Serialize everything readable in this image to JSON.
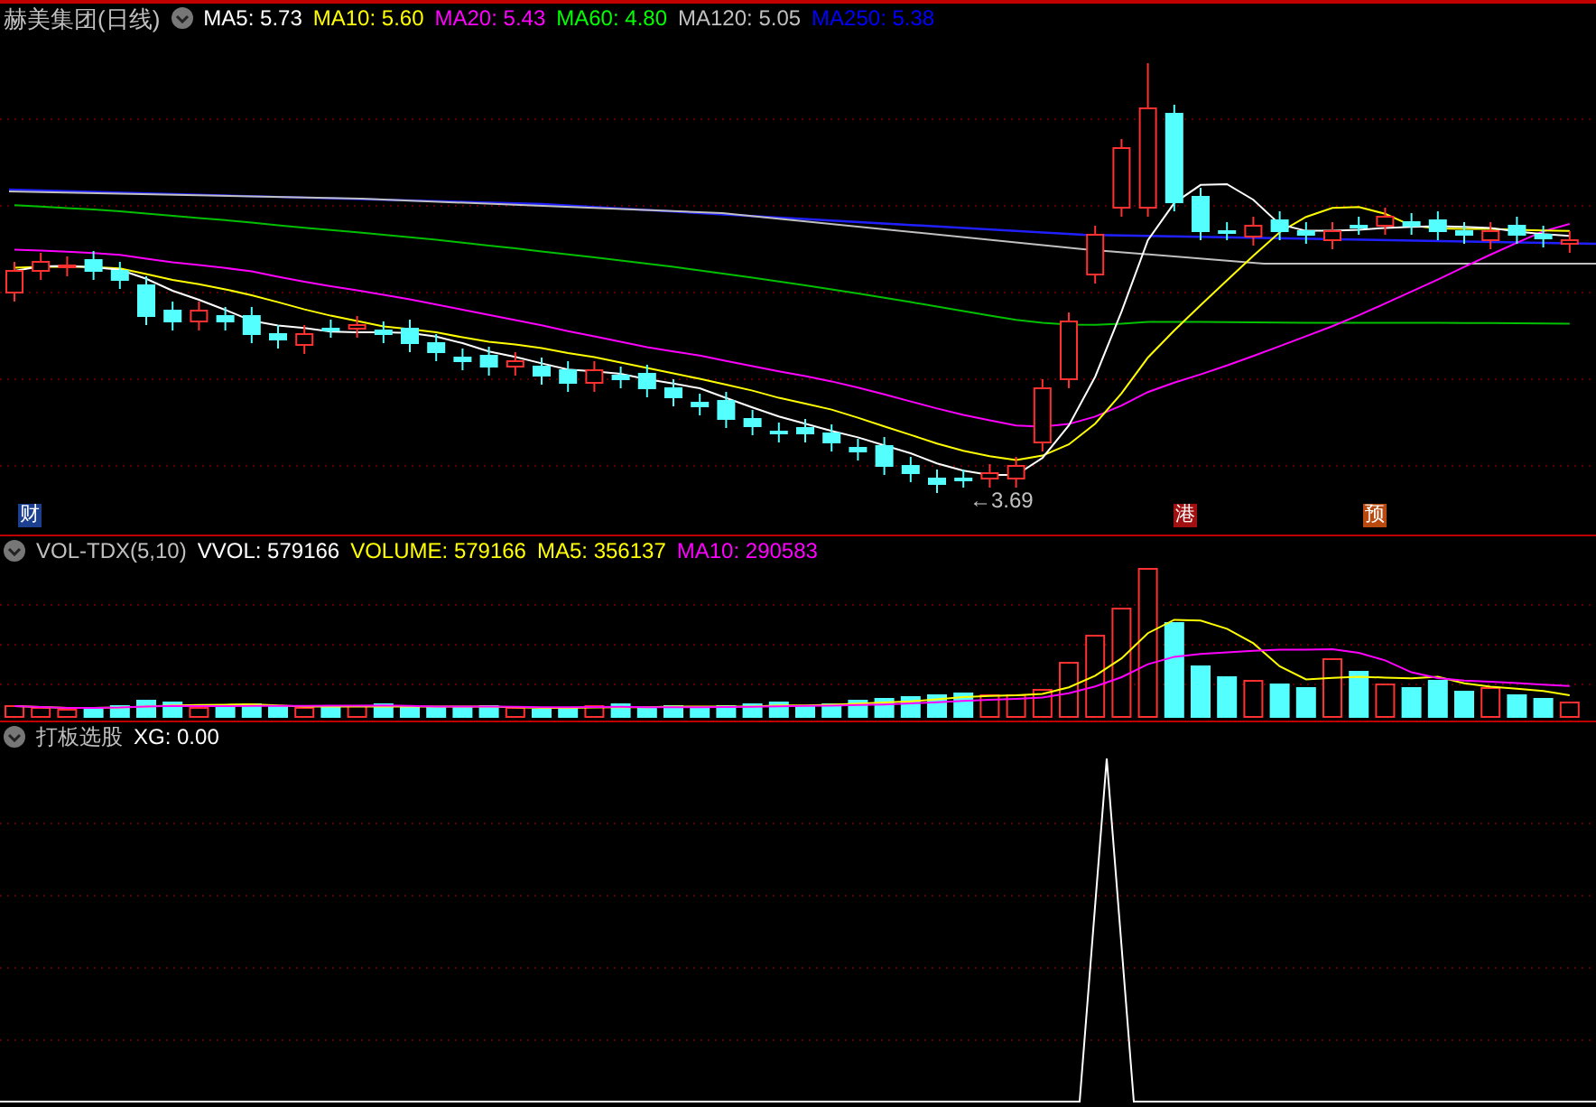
{
  "main_panel": {
    "title": "赫美集团(日线)",
    "legend": [
      {
        "label": "MA5: 5.73",
        "color": "#ffffff"
      },
      {
        "label": "MA10: 5.60",
        "color": "#ffff00"
      },
      {
        "label": "MA20: 5.43",
        "color": "#ff00ff"
      },
      {
        "label": "MA60: 4.80",
        "color": "#00ff00"
      },
      {
        "label": "MA120: 5.05",
        "color": "#c0c0c0"
      },
      {
        "label": "MA250: 5.38",
        "color": "#0000ff"
      }
    ],
    "low_label": "←3.69",
    "markers": [
      {
        "text": "财",
        "color": "#1c3f8f"
      },
      {
        "text": "港",
        "color": "#a01010"
      },
      {
        "text": "预",
        "color": "#b84a10"
      }
    ]
  },
  "volume_panel": {
    "title": "VOL-TDX(5,10)",
    "legend": [
      {
        "label": "VVOL: 579166",
        "color": "#ffffff"
      },
      {
        "label": "VOLUME: 579166",
        "color": "#ffff00"
      },
      {
        "label": "MA5: 356137",
        "color": "#ffff00"
      },
      {
        "label": "MA10: 290583",
        "color": "#ff00ff"
      }
    ]
  },
  "signal_panel": {
    "title": "打板选股",
    "legend": [
      {
        "label": "XG: 0.00",
        "color": "#ffffff"
      }
    ]
  }
}
